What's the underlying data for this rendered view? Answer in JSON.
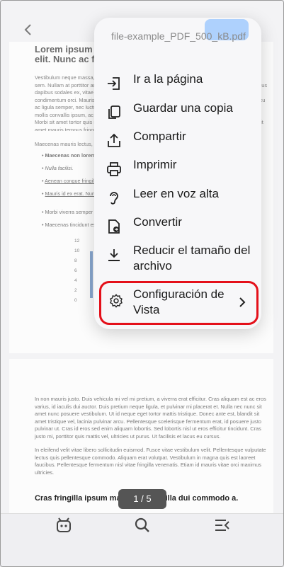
{
  "document": {
    "title": "Lorem ipsum dolor sit amet, consectetur adipiscing elit. Nunc ac fa...",
    "paragraph1": "Vestibulum neque massa, scelerisque sit amet ligula eu, congue molestie mi. Praesent ut varius sem. Nullam at porttitor arcu, nec lacinia nisi. Ut ac dolor vitae odio interdum condimentum. Vivamus dapibus sodales ex, vitae malesuada ipsum cursus convallis. Maecenas sed egestas nulla, ac condimentum orci. Mauris diam felis, vulputate ac suscipit et, iaculis non est. Curabitur semper arcu ac ligula semper, nec luctus nisl blandit. Integer lacinia ante ac libero lobortis imperdiet. Nullam mollis convallis ipsum, ac accumsan nunc vehicula vitae. Nulla eget justo in felis tristique fringilla. Morbi sit amet tortor quis risus auctor condimentum. Morbi in ullamcorper elit. Nulla iaculis tellus sit amet mauris tempus fringilla.",
    "paragraph2": "Maecenas mauris lectus, lobortis et purus mattis, blandit dictum tellus.",
    "list": [
      "Maecenas non lorem quis tellus placerat varius.",
      "Nulla facilisi.",
      "Aenean congue fringilla justo ut aliquam.",
      "Mauris id ex erat. Nunc vulputate neque vitae justo facilisis, non condimentum ante sagittis.",
      "Morbi viverra semper lorem nec molestie.",
      "Maecenas tincidunt est efficitur ligula euismod, sit amet ornare est vulputate."
    ],
    "chart_ticks": [
      "12",
      "10",
      "8",
      "6",
      "4",
      "2",
      "0"
    ],
    "page2_para1": "In non mauris justo. Duis vehicula mi vel mi pretium, a viverra erat efficitur. Cras aliquam est ac eros varius, id iaculis dui auctor. Duis pretium neque ligula, et pulvinar mi placerat et. Nulla nec nunc sit amet nunc posuere vestibulum. Ut id neque eget tortor mattis tristique. Donec ante est, blandit sit amet tristique vel, lacinia pulvinar arcu. Pellentesque scelerisque fermentum erat, id posuere justo pulvinar ut. Cras id eros sed enim aliquam lobortis. Sed lobortis nisl ut eros efficitur tincidunt. Cras justo mi, porttitor quis mattis vel, ultricies ut purus. Ut facilisis et lacus eu cursus.",
    "page2_para2": "In eleifend velit vitae libero sollicitudin euismod. Fusce vitae vestibulum velit. Pellentesque vulputate lectus quis pellentesque commodo. Aliquam erat volutpat. Vestibulum in magna quis est laoreet faucibus. Pellentesque fermentum nisl vitae fringilla venenatis. Etiam id mauris vitae orci maximus ultricies.",
    "page2_heading": "Cras fringilla ipsum magna, in fringilla dui commodo a."
  },
  "pager": "1 / 5",
  "menu": {
    "filename": "file-example_PDF_500_kB.pdf",
    "items": [
      {
        "icon": "go-to-page-icon",
        "label": "Ir a la página"
      },
      {
        "icon": "copy-icon",
        "label": "Guardar una copia"
      },
      {
        "icon": "share-icon",
        "label": "Compartir"
      },
      {
        "icon": "print-icon",
        "label": "Imprimir"
      },
      {
        "icon": "read-aloud-icon",
        "label": "Leer en voz alta"
      },
      {
        "icon": "convert-icon",
        "label": "Convertir"
      },
      {
        "icon": "reduce-size-icon",
        "label": "Reducir el tamaño del archivo"
      },
      {
        "icon": "settings-icon",
        "label": "Configuración de Vista"
      }
    ]
  },
  "colors": {
    "highlight_border": "#e4101a",
    "accent_blue": "#8ec0ff"
  }
}
